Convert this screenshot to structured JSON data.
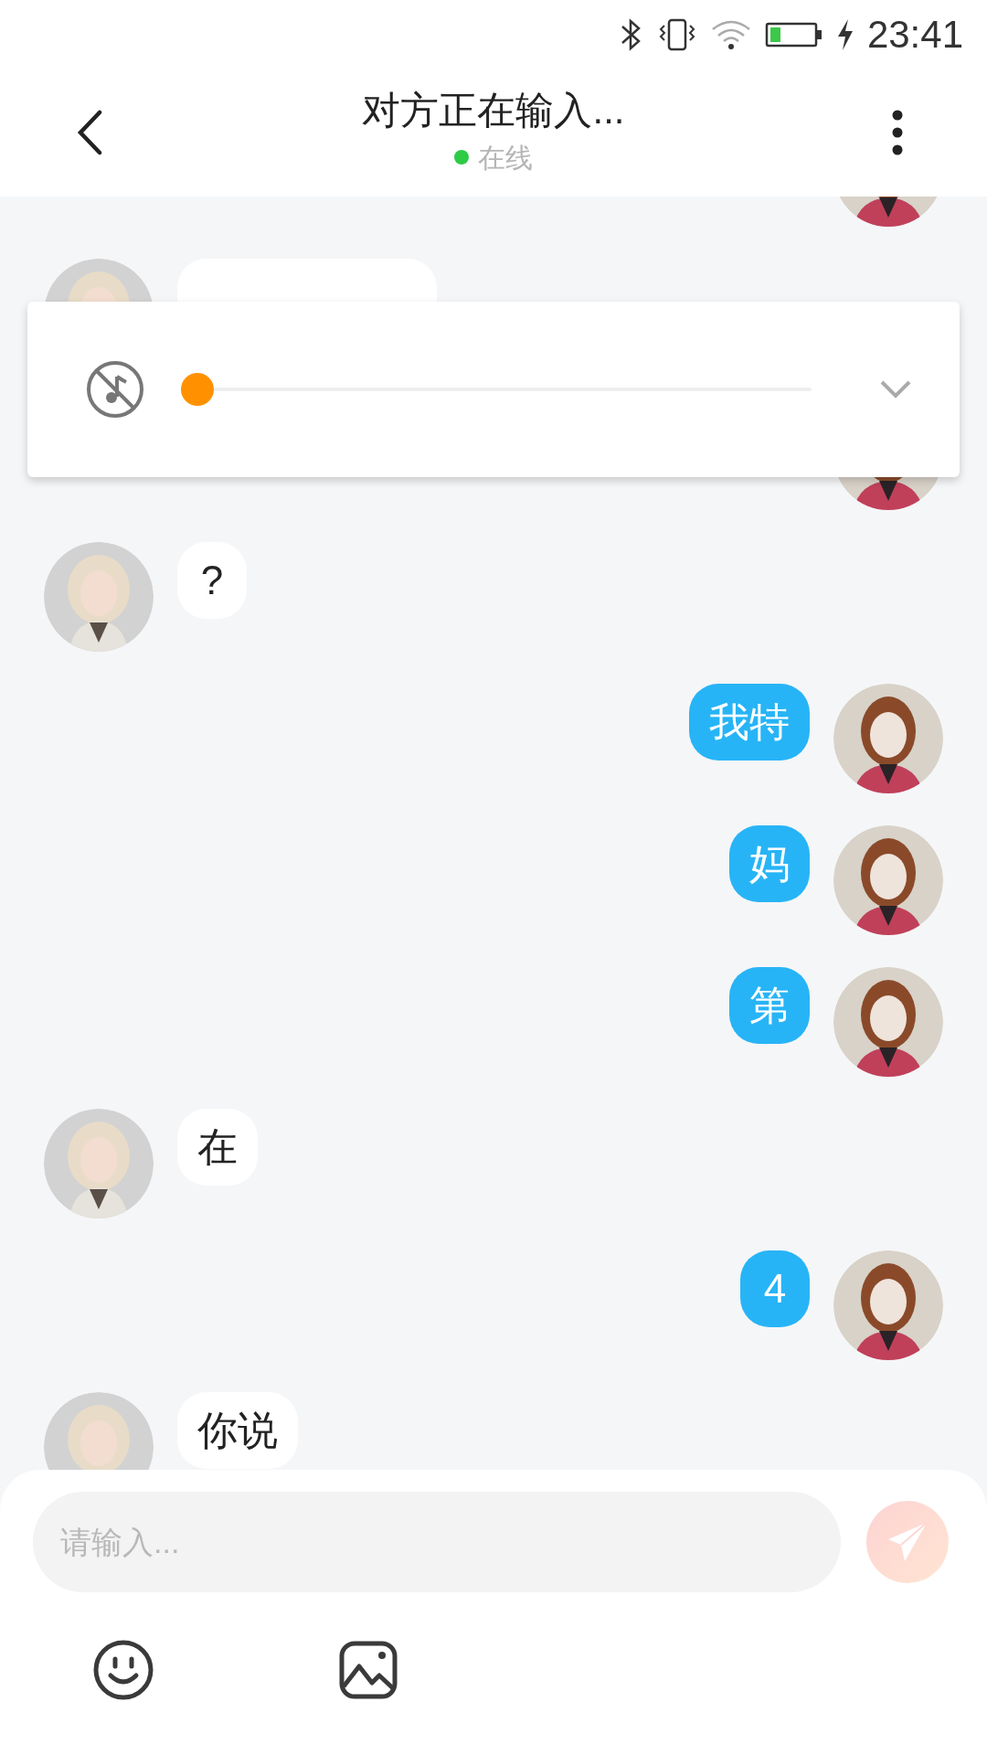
{
  "status_bar": {
    "time": "23:41"
  },
  "header": {
    "title": "对方正在输入...",
    "status": "在线",
    "online": true
  },
  "messages": [
    {
      "kind": "sent"
    },
    {
      "kind": "received"
    },
    {
      "kind": "sent"
    },
    {
      "kind": "received",
      "text": "?"
    },
    {
      "kind": "sent",
      "text": "我特"
    },
    {
      "kind": "sent",
      "text": "妈"
    },
    {
      "kind": "sent",
      "text": "第"
    },
    {
      "kind": "received",
      "text": "在"
    },
    {
      "kind": "sent",
      "text": "4"
    },
    {
      "kind": "received",
      "text": "你说"
    }
  ],
  "player": {
    "muted": true,
    "level": 0
  },
  "composer": {
    "placeholder": "请输入..."
  }
}
